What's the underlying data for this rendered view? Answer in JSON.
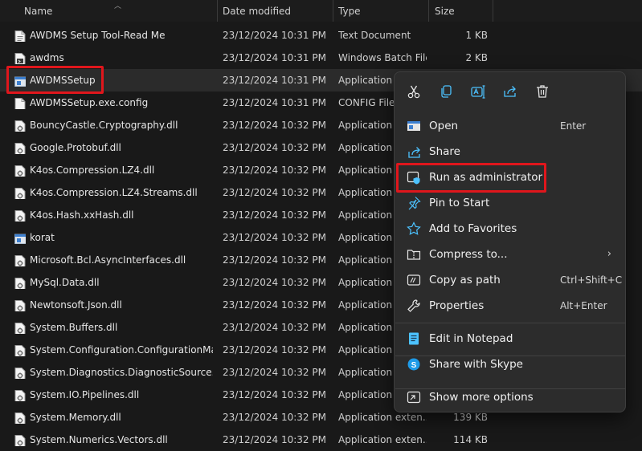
{
  "columns": {
    "name": "Name",
    "date": "Date modified",
    "type": "Type",
    "size": "Size"
  },
  "files": [
    {
      "name": "AWDMS Setup Tool-Read Me",
      "date": "23/12/2024 10:31 PM",
      "type": "Text Document",
      "size": "1 KB",
      "icon": "text-file-icon"
    },
    {
      "name": "awdms",
      "date": "23/12/2024 10:31 PM",
      "type": "Windows Batch File",
      "size": "2 KB",
      "icon": "batch-file-icon"
    },
    {
      "name": "AWDMSSetup",
      "date": "23/12/2024 10:31 PM",
      "type": "Application",
      "size": "",
      "icon": "application-icon"
    },
    {
      "name": "AWDMSSetup.exe.config",
      "date": "23/12/2024 10:31 PM",
      "type": "CONFIG File",
      "size": "",
      "icon": "config-file-icon"
    },
    {
      "name": "BouncyCastle.Cryptography.dll",
      "date": "23/12/2024 10:32 PM",
      "type": "Application e",
      "size": "",
      "icon": "dll-file-icon"
    },
    {
      "name": "Google.Protobuf.dll",
      "date": "23/12/2024 10:32 PM",
      "type": "Application e",
      "size": "",
      "icon": "dll-file-icon"
    },
    {
      "name": "K4os.Compression.LZ4.dll",
      "date": "23/12/2024 10:32 PM",
      "type": "Application e",
      "size": "",
      "icon": "dll-file-icon"
    },
    {
      "name": "K4os.Compression.LZ4.Streams.dll",
      "date": "23/12/2024 10:32 PM",
      "type": "Application e",
      "size": "",
      "icon": "dll-file-icon"
    },
    {
      "name": "K4os.Hash.xxHash.dll",
      "date": "23/12/2024 10:32 PM",
      "type": "Application e",
      "size": "",
      "icon": "dll-file-icon"
    },
    {
      "name": "korat",
      "date": "23/12/2024 10:32 PM",
      "type": "Application",
      "size": "",
      "icon": "application-icon"
    },
    {
      "name": "Microsoft.Bcl.AsyncInterfaces.dll",
      "date": "23/12/2024 10:32 PM",
      "type": "Application e",
      "size": "",
      "icon": "dll-file-icon"
    },
    {
      "name": "MySql.Data.dll",
      "date": "23/12/2024 10:32 PM",
      "type": "Application e",
      "size": "",
      "icon": "dll-file-icon"
    },
    {
      "name": "Newtonsoft.Json.dll",
      "date": "23/12/2024 10:32 PM",
      "type": "Application e",
      "size": "",
      "icon": "dll-file-icon"
    },
    {
      "name": "System.Buffers.dll",
      "date": "23/12/2024 10:32 PM",
      "type": "Application e",
      "size": "",
      "icon": "dll-file-icon"
    },
    {
      "name": "System.Configuration.ConfigurationMan...",
      "date": "23/12/2024 10:32 PM",
      "type": "Application e",
      "size": "",
      "icon": "dll-file-icon"
    },
    {
      "name": "System.Diagnostics.DiagnosticSource.dll",
      "date": "23/12/2024 10:32 PM",
      "type": "Application e",
      "size": "",
      "icon": "dll-file-icon"
    },
    {
      "name": "System.IO.Pipelines.dll",
      "date": "23/12/2024 10:32 PM",
      "type": "Application e",
      "size": "",
      "icon": "dll-file-icon"
    },
    {
      "name": "System.Memory.dll",
      "date": "23/12/2024 10:32 PM",
      "type": "Application exten...",
      "size": "139 KB",
      "icon": "dll-file-icon"
    },
    {
      "name": "System.Numerics.Vectors.dll",
      "date": "23/12/2024 10:32 PM",
      "type": "Application exten...",
      "size": "114 KB",
      "icon": "dll-file-icon"
    }
  ],
  "context_menu": {
    "quick_actions": [
      "cut-icon",
      "copy-icon",
      "rename-icon",
      "share-icon",
      "delete-icon"
    ],
    "items": [
      {
        "label": "Open",
        "shortcut": "Enter",
        "icon": "open-icon"
      },
      {
        "label": "Share",
        "shortcut": "",
        "icon": "share-icon"
      },
      {
        "label": "Run as administrator",
        "shortcut": "",
        "icon": "shield-admin-icon"
      },
      {
        "label": "Pin to Start",
        "shortcut": "",
        "icon": "pin-icon"
      },
      {
        "label": "Add to Favorites",
        "shortcut": "",
        "icon": "star-icon"
      },
      {
        "label": "Compress to...",
        "shortcut": "",
        "icon": "zip-folder-icon",
        "submenu": true
      },
      {
        "label": "Copy as path",
        "shortcut": "Ctrl+Shift+C",
        "icon": "copy-path-icon"
      },
      {
        "label": "Properties",
        "shortcut": "Alt+Enter",
        "icon": "wrench-icon"
      },
      {
        "label": "Edit in Notepad",
        "shortcut": "",
        "icon": "notepad-icon"
      },
      {
        "label": "Share with Skype",
        "shortcut": "",
        "icon": "skype-icon"
      },
      {
        "label": "Show more options",
        "shortcut": "",
        "icon": "more-options-icon"
      }
    ]
  },
  "colors": {
    "background": "#191919",
    "menu": "#2c2c2c",
    "highlight": "#e0161c",
    "accent": "#4cc2ff"
  }
}
